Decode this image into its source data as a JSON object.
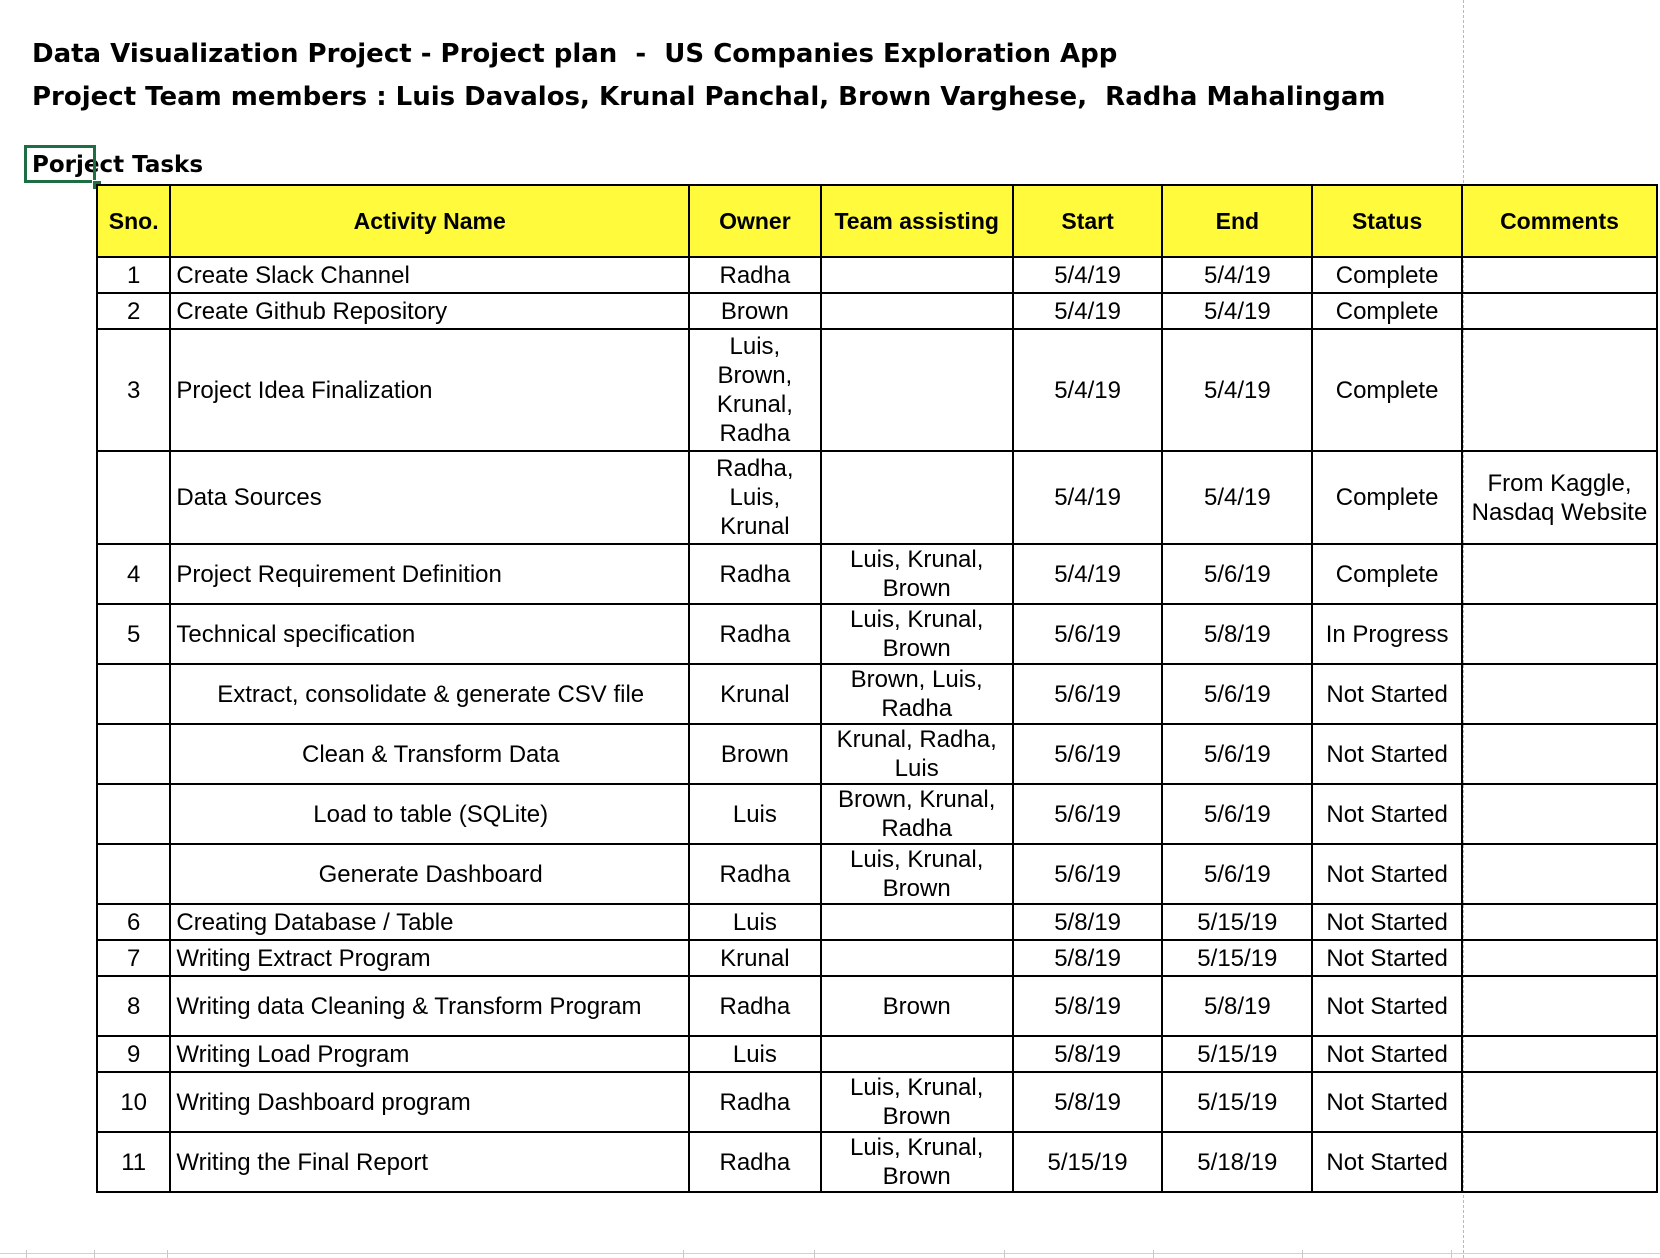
{
  "sheet": {
    "title_line1": "Data Visualization Project - Project plan  -  US Companies Exploration App",
    "title_line2": "Project Team members : Luis Davalos, Krunal Panchal, Brown Varghese,  Radha Mahalingam",
    "section_label": "Porject Tasks"
  },
  "table": {
    "headers": {
      "sno": "Sno.",
      "activity": "Activity Name",
      "owner": "Owner",
      "team": "Team assisting",
      "start": "Start",
      "end": "End",
      "status": "Status",
      "comments": "Comments"
    },
    "rows": [
      {
        "sno": "1",
        "activity": "Create Slack Channel",
        "owner": "Radha",
        "team": "",
        "start": "5/4/19",
        "end": "5/4/19",
        "status": "Complete",
        "comments": "",
        "sub": false,
        "lines": 1
      },
      {
        "sno": "2",
        "activity": "Create Github Repository",
        "owner": "Brown",
        "team": "",
        "start": "5/4/19",
        "end": "5/4/19",
        "status": "Complete",
        "comments": "",
        "sub": false,
        "lines": 1
      },
      {
        "sno": "3",
        "activity": "Project Idea Finalization",
        "owner": "Luis,\nBrown,\nKrunal,\nRadha",
        "team": "",
        "start": "5/4/19",
        "end": "5/4/19",
        "status": "Complete",
        "comments": "",
        "sub": false,
        "lines": 4
      },
      {
        "sno": "",
        "activity": "Data Sources",
        "owner": "Radha,\nLuis,\nKrunal",
        "team": "",
        "start": "5/4/19",
        "end": "5/4/19",
        "status": "Complete",
        "comments": "From Kaggle,\nNasdaq Website",
        "sub": false,
        "lines": 3
      },
      {
        "sno": "4",
        "activity": "Project Requirement Definition",
        "owner": "Radha",
        "team": "Luis, Krunal,\nBrown",
        "start": "5/4/19",
        "end": "5/6/19",
        "status": "Complete",
        "comments": "",
        "sub": false,
        "lines": 2
      },
      {
        "sno": "5",
        "activity": "Technical specification",
        "owner": "Radha",
        "team": "Luis, Krunal,\nBrown",
        "start": "5/6/19",
        "end": "5/8/19",
        "status": "In Progress",
        "comments": "",
        "sub": false,
        "lines": 2
      },
      {
        "sno": "",
        "activity": "Extract, consolidate & generate CSV file",
        "owner": "Krunal",
        "team": "Brown, Luis,\nRadha",
        "start": "5/6/19",
        "end": "5/6/19",
        "status": "Not Started",
        "comments": "",
        "sub": true,
        "lines": 2
      },
      {
        "sno": "",
        "activity": "Clean & Transform Data",
        "owner": "Brown",
        "team": "Krunal, Radha,\nLuis",
        "start": "5/6/19",
        "end": "5/6/19",
        "status": "Not Started",
        "comments": "",
        "sub": true,
        "lines": 2
      },
      {
        "sno": "",
        "activity": "Load to table (SQLite)",
        "owner": "Luis",
        "team": "Brown, Krunal,\nRadha",
        "start": "5/6/19",
        "end": "5/6/19",
        "status": "Not Started",
        "comments": "",
        "sub": true,
        "lines": 2
      },
      {
        "sno": "",
        "activity": "Generate Dashboard",
        "owner": "Radha",
        "team": "Luis, Krunal,\nBrown",
        "start": "5/6/19",
        "end": "5/6/19",
        "status": "Not Started",
        "comments": "",
        "sub": true,
        "lines": 2
      },
      {
        "sno": "6",
        "activity": "Creating Database / Table",
        "owner": "Luis",
        "team": "",
        "start": "5/8/19",
        "end": "5/15/19",
        "status": "Not Started",
        "comments": "",
        "sub": false,
        "lines": 1
      },
      {
        "sno": "7",
        "activity": "Writing Extract Program",
        "owner": "Krunal",
        "team": "",
        "start": "5/8/19",
        "end": "5/15/19",
        "status": "Not Started",
        "comments": "",
        "sub": false,
        "lines": 1
      },
      {
        "sno": "8",
        "activity": "Writing data Cleaning & Transform Program",
        "owner": "Radha",
        "team": "Brown",
        "start": "5/8/19",
        "end": "5/8/19",
        "status": "Not Started",
        "comments": "",
        "sub": false,
        "lines": 2
      },
      {
        "sno": "9",
        "activity": "Writing Load Program",
        "owner": "Luis",
        "team": "",
        "start": "5/8/19",
        "end": "5/15/19",
        "status": "Not Started",
        "comments": "",
        "sub": false,
        "lines": 1
      },
      {
        "sno": "10",
        "activity": "Writing Dashboard program",
        "owner": "Radha",
        "team": "Luis, Krunal,\nBrown",
        "start": "5/8/19",
        "end": "5/15/19",
        "status": "Not Started",
        "comments": "",
        "sub": false,
        "lines": 2
      },
      {
        "sno": "11",
        "activity": "Writing the Final Report",
        "owner": "Radha",
        "team": "Luis, Krunal,\nBrown",
        "start": "5/15/19",
        "end": "5/18/19",
        "status": "Not Started",
        "comments": "",
        "sub": false,
        "lines": 2
      }
    ]
  },
  "colors": {
    "header_fill": "#fffb3c",
    "selection_border": "#1f6e43"
  }
}
